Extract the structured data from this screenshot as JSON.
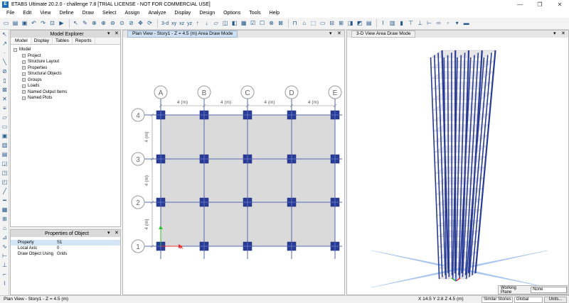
{
  "window": {
    "title": "ETABS Ultimate 20.2.0 - challenge 7.8  [TRIAL LICENSE - NOT FOR COMMERCIAL USE]",
    "app_icon": "E",
    "minimize": "—",
    "maximize": "❐",
    "close": "✕"
  },
  "menu": [
    "File",
    "Edit",
    "View",
    "Define",
    "Draw",
    "Select",
    "Assign",
    "Analyze",
    "Display",
    "Design",
    "Options",
    "Tools",
    "Help"
  ],
  "toolbar": {
    "view_3d_label": "3-d",
    "xy_label": "xy",
    "xz_label": "xz",
    "yz_label": "yz"
  },
  "model_explorer": {
    "title": "Model Explorer",
    "pin": "▾",
    "close": "✕",
    "tabs": [
      "Model",
      "Display",
      "Tables",
      "Reports"
    ],
    "root": "Model",
    "items": [
      "Project",
      "Structure Layout",
      "Properties",
      "Structural Objects",
      "Groups",
      "Loads",
      "Named Output Items",
      "Named Plots"
    ]
  },
  "properties": {
    "title": "Properties of Object",
    "rows": [
      {
        "name": "Property",
        "value": "S1"
      },
      {
        "name": "Local Axis",
        "value": "0"
      },
      {
        "name": "Draw Object Using",
        "value": "Grids"
      }
    ]
  },
  "plan_view": {
    "tab": "Plan View - Story1 - Z = 4.5 (m)  Area Draw Mode",
    "grid_x": [
      "A",
      "B",
      "C",
      "D",
      "E"
    ],
    "grid_y": [
      "4",
      "3",
      "2",
      "1"
    ],
    "spacing_label": "4 (m)"
  },
  "view_3d": {
    "tab": "3-D View  Area Draw Mode"
  },
  "status": {
    "left": "Plan View - Story1 - Z = 4.5 (m)",
    "coords": "X 14.5  Y 2.8  Z 4.5 (m)",
    "stories": "Similar Stories",
    "coord_system": "Global",
    "units": "Units..."
  },
  "working_plane": {
    "label": "Working Plane",
    "value": "None"
  },
  "colors": {
    "column": "#283b96",
    "beam": "#5467b2",
    "slab": "#dadada",
    "grid_bubble": "#9a9a9a"
  }
}
